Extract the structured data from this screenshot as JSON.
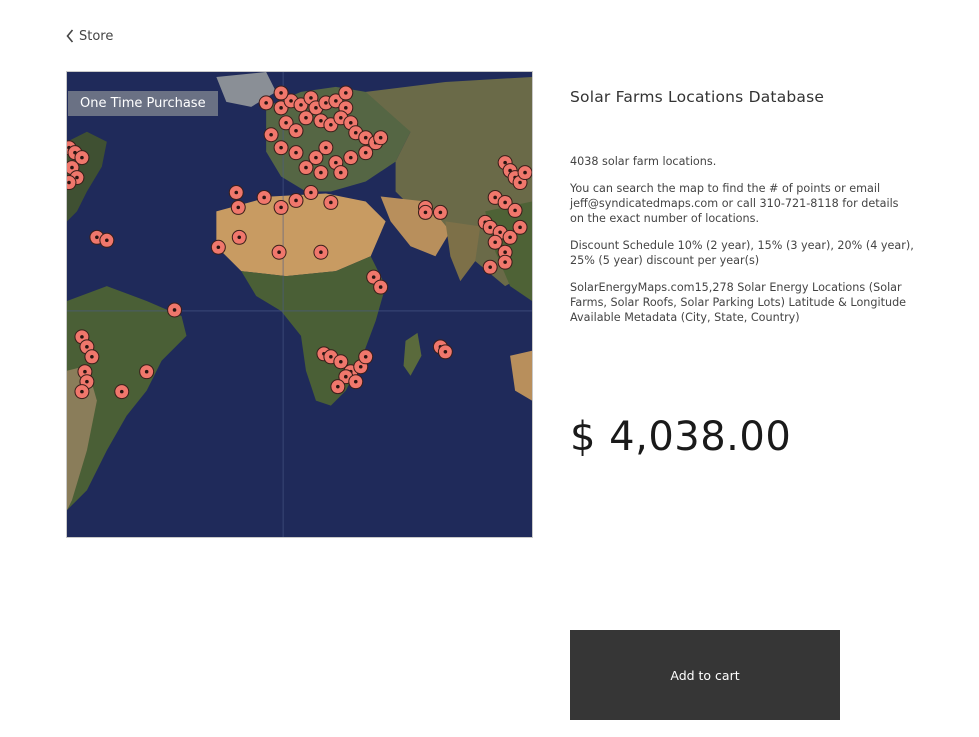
{
  "nav": {
    "back_label": "Store"
  },
  "product": {
    "badge": "One Time Purchase",
    "title": "Solar Farms Locations Database",
    "description": {
      "count_text": "4038 solar farm locations.",
      "search_text_before": "You can search the map to find the # of points or email ",
      "email": "jeff@syndicatedmaps.com",
      "search_text_after": " or call 310-721-8118 for details on the exact number of locations.",
      "discount_text": "Discount Schedule 10% (2 year), 15% (3 year), 20% (4 year), 25% (5 year) discount per year(s)",
      "metadata_text": "SolarEnergyMaps.com15,278 Solar Energy Locations (Solar Farms, Solar Roofs, Solar Parking Lots) Latitude & Longitude Available Metadata (City, State, Country)"
    },
    "price": "$ 4,038.00",
    "add_to_cart_label": "Add to cart"
  },
  "map": {
    "colors": {
      "ocean": "#1f2a5a",
      "desert": "#c89b62",
      "vegetation": "#4a5f36",
      "marker": "#f0776c",
      "marker_stroke": "#3a1e1a"
    }
  }
}
